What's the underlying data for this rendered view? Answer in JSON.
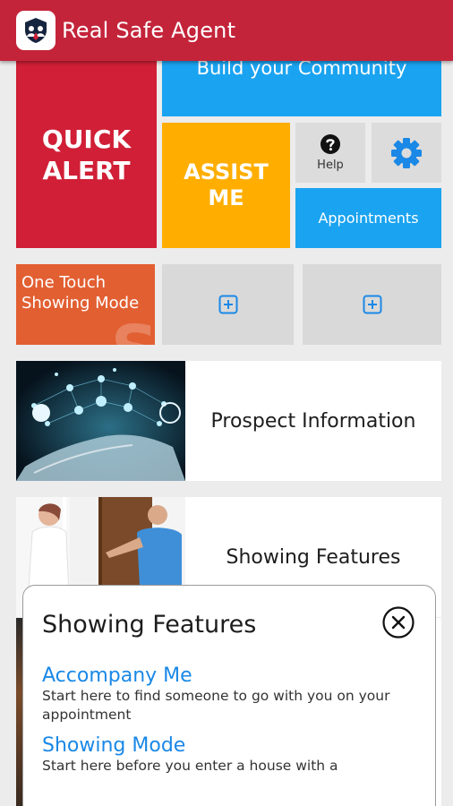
{
  "app_bar": {
    "title": "Real Safe Agent",
    "logo_icon": "shield-people-logo",
    "color": "#c4243a"
  },
  "tiles": {
    "quick_alert": {
      "line1": "QUICK",
      "line2": "ALERT",
      "color": "#d01f36"
    },
    "build_community": {
      "label": "Build your Community",
      "color": "#1aa3f0"
    },
    "assist_me": {
      "line1": "ASSIST",
      "line2": "ME",
      "color": "#ffae00"
    },
    "help": {
      "label": "Help",
      "icon": "question-circle-icon"
    },
    "settings": {
      "icon": "gear-icon",
      "color": "#1a88e6"
    },
    "appointments": {
      "label": "Appointments",
      "color": "#1aa3f0"
    },
    "one_touch": {
      "line1": "One Touch",
      "line2": "Showing Mode",
      "color": "#e25f32"
    },
    "add_slots": [
      {
        "icon": "plus-square-icon"
      },
      {
        "icon": "plus-square-icon"
      }
    ]
  },
  "cards": [
    {
      "label": "Prospect Information",
      "image": "network-hand-image"
    },
    {
      "label": "Showing Features",
      "image": "agent-showing-house-image"
    }
  ],
  "popup": {
    "title": "Showing Features",
    "close_icon": "close-circle-icon",
    "features": [
      {
        "title": "Accompany Me",
        "description": "Start here to find someone to go with you on your appointment"
      },
      {
        "title": "Showing Mode",
        "description": "Start here before you enter a house with a"
      }
    ],
    "link_color": "#1a88e6"
  }
}
